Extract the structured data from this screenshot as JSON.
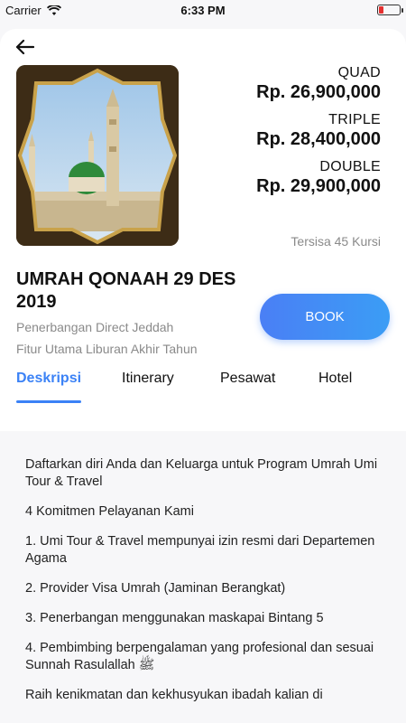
{
  "status_bar": {
    "carrier": "Carrier",
    "time": "6:33 PM"
  },
  "package": {
    "title": "UMRAH QONAAH 29 DES 2019",
    "subtitle_1": "Penerbangan Direct Jeddah",
    "subtitle_2": "Fitur Utama Liburan Akhir Tahun",
    "seats_left": "Tersisa 45 Kursi",
    "image": "mosque-photo"
  },
  "prices": [
    {
      "label": "QUAD",
      "value": "Rp. 26,900,000"
    },
    {
      "label": "TRIPLE",
      "value": "Rp. 28,400,000"
    },
    {
      "label": "DOUBLE",
      "value": "Rp. 29,900,000"
    }
  ],
  "actions": {
    "book_label": "BOOK"
  },
  "tabs": [
    {
      "label": "Deskripsi",
      "active": true
    },
    {
      "label": "Itinerary",
      "active": false
    },
    {
      "label": "Pesawat",
      "active": false
    },
    {
      "label": "Hotel",
      "active": false
    }
  ],
  "description": [
    "Daftarkan diri Anda dan Keluarga untuk Program Umrah Umi Tour & Travel",
    "4 Komitmen Pelayanan Kami",
    "1. Umi Tour & Travel mempunyai izin resmi dari Departemen Agama",
    "2. Provider Visa Umrah (Jaminan Berangkat)",
    "3. Penerbangan menggunakan maskapai Bintang 5",
    "4. Pembimbing berpengalaman yang profesional dan sesuai Sunnah Rasulallah ﷺ",
    "Raih kenikmatan dan kekhusyukan ibadah kalian di"
  ],
  "colors": {
    "accent": "#3b82f6",
    "battery_low": "#e63030"
  }
}
